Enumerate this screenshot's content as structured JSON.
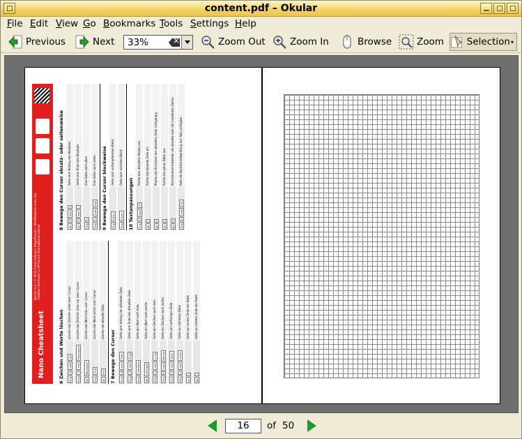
{
  "window": {
    "title": "content.pdf – Okular"
  },
  "menu": [
    {
      "label": "File",
      "accel": "F",
      "rest": "ile"
    },
    {
      "label": "Edit",
      "accel": "E",
      "rest": "dit"
    },
    {
      "label": "View",
      "accel": "V",
      "rest": "iew"
    },
    {
      "label": "Go",
      "accel": "G",
      "rest": "o"
    },
    {
      "label": "Bookmarks",
      "accel": "B",
      "rest": "ookmarks"
    },
    {
      "label": "Tools",
      "accel": "T",
      "rest": "ools"
    },
    {
      "label": "Settings",
      "accel": "S",
      "rest": "ettings"
    },
    {
      "label": "Help",
      "accel": "H",
      "rest": "elp"
    }
  ],
  "toolbar": {
    "previous": "Previous",
    "next": "Next",
    "zoom_value": "33%",
    "zoom_out": "Zoom Out",
    "zoom_in": "Zoom In",
    "browse": "Browse",
    "zoom": "Zoom",
    "selection": "Selection"
  },
  "document": {
    "left_page": {
      "header_title": "Nano Cheatsheet",
      "license_text": "Version 0.2 • © 2023 Frank Hofmann (fh@efho.de) • Veröffentlicht unter der Creative Commons CC-BY-SA 4.0 International License",
      "col1_heading1": "6 Zeichen und Worte löschen",
      "col1_rows1": [
        {
          "keys": [
            "Strg",
            "d",
            "oder",
            "Del"
          ],
          "desc": "Lösche das Zeichen unter dem Cursor"
        },
        {
          "keys": [
            "Strg",
            "h",
            "oder",
            "Backspace"
          ],
          "desc": "Lösche das Zeichen links vor dem Cursor"
        },
        {
          "keys": [
            "Alt",
            "Backspace"
          ],
          "desc": "Lösche das Wort links vom Cursor"
        },
        {
          "keys": [
            "Strg",
            "Entf"
          ],
          "desc": "Lösche das Wort rechts vom Cursor"
        },
        {
          "keys": [
            "Alt",
            "Entf"
          ],
          "desc": "Lösche die aktuelle Zeile"
        }
      ],
      "col1_heading2": "7 Bewege den Cursor",
      "col1_rows2": [
        {
          "keys": [
            "Strg",
            "a",
            "oder",
            "Pos1"
          ],
          "desc": "Gehe zum Anfang der aktuellen Zeile"
        },
        {
          "keys": [
            "Strg",
            "e",
            "oder",
            "Ende"
          ],
          "desc": "Gehe zum Ende der aktuellen Zeile"
        },
        {
          "keys": [
            "Strg",
            "Leertaste"
          ],
          "desc": "Gehe ein Wort nach links"
        },
        {
          "keys": [
            "Alt",
            "Leertaste"
          ],
          "desc": "Gehe ein Wort nach rechts"
        },
        {
          "keys": [
            "Strg",
            "b",
            "oder",
            "Links"
          ],
          "desc": "Gehe ein Zeichen nach links"
        },
        {
          "keys": [
            "Strg",
            "f",
            "oder",
            "Rechts"
          ],
          "desc": "Gehe ein Zeichen nach rechts"
        },
        {
          "keys": [
            "Strg",
            "p",
            "oder",
            "Oben"
          ],
          "desc": "Gehe zur vorherigen Zeile"
        },
        {
          "keys": [
            "Strg",
            "n",
            "oder",
            "Unten"
          ],
          "desc": "Gehe zur nächsten Zeile"
        },
        {
          "keys": [
            "Alt",
            "\\"
          ],
          "desc": "Gehe zur ersten Zeile der Datei"
        },
        {
          "keys": [
            "Alt",
            "/"
          ],
          "desc": "Gehe zur letzten Zeile der Datei"
        }
      ],
      "col2_heading1": "8 Bewege den Cursor absatz- oder seitenweise",
      "col2_rows1": [
        {
          "keys": [
            "Alt",
            "9",
            "oder",
            "("
          ],
          "desc": "Gehe zum Anfang des Absatzes"
        },
        {
          "keys": [
            "Alt",
            "0",
            "oder",
            ")"
          ],
          "desc": "Gehe zum Ende des Absatzes"
        },
        {
          "keys": [
            "Strg",
            "v"
          ],
          "desc": "Eine Seite nach oben"
        },
        {
          "keys": [
            "Strg",
            "y",
            "oder",
            "Bild"
          ],
          "desc": "Eine Seite nach unten"
        }
      ],
      "col2_heading2": "9 Bewege den Cursor blockweise",
      "col2_rows2": [
        {
          "keys": [
            "Strg",
            "Oben"
          ],
          "desc": "Gehe zum vorhergehenden Block"
        },
        {
          "keys": [
            "Strg",
            "Unten"
          ],
          "desc": "Gehe zum nächsten Block"
        }
      ],
      "col2_heading3": "10 Textanpassungen",
      "col2_rows3": [
        {
          "keys": [
            "Strg",
            "J",
            "oder",
            "F4"
          ],
          "desc": "Richte den aktuellen Absatz aus"
        },
        {
          "keys": [
            "Alt",
            "J"
          ],
          "desc": "Richte die aktuelle Zeile ein"
        },
        {
          "keys": [
            "Alt",
            "I"
          ],
          "desc": "Mache das Einrücken der aktuellen Zeile rückgängig"
        },
        {
          "keys": [
            "Alt",
            "J"
          ],
          "desc": "Richte die ganze Datei aus"
        },
        {
          "keys": [
            "Alt",
            "3"
          ],
          "desc": "Kommentiere entweder die aktuelle oder die markierten Zeilen"
        },
        {
          "keys": [
            "Strg",
            "T",
            "oder",
            "F12"
          ],
          "desc": "Rufe die Rechtschreibprüfung auf, falls verfügbar"
        }
      ]
    }
  },
  "navigation": {
    "current_page": "16",
    "of_label": "of",
    "total_pages": "50"
  },
  "colors": {
    "titlebar": "#f3d56a",
    "chrome": "#efebd8",
    "viewport": "#6e6e6e",
    "nav_arrow": "#1e9a2a",
    "cheatsheet_red": "#e0201e"
  },
  "icons": {
    "previous": "arrow-left-icon",
    "next": "arrow-right-icon",
    "zoom_out": "magnifier-minus-icon",
    "zoom_in": "magnifier-plus-icon",
    "browse": "mouse-icon",
    "zoom": "zoom-rect-icon",
    "selection": "selection-icon"
  }
}
